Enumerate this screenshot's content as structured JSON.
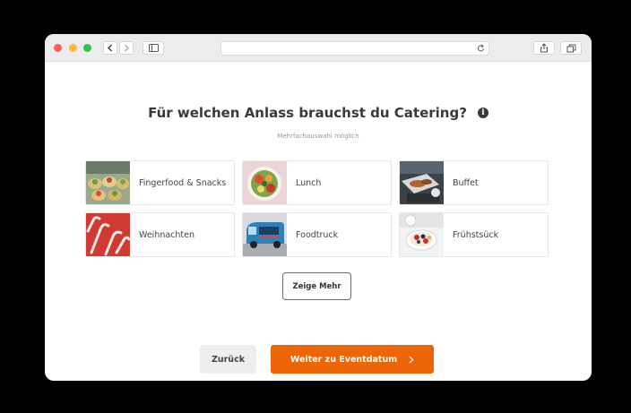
{
  "browser": {
    "url": ""
  },
  "page": {
    "title": "Für welchen Anlass brauchst du Catering?",
    "subtitle": "Mehrfachauswahl möglich"
  },
  "options": [
    {
      "label": "Fingerfood & Snacks",
      "image": "fingerfood-photo"
    },
    {
      "label": "Lunch",
      "image": "lunch-bowl-photo"
    },
    {
      "label": "Buffet",
      "image": "buffet-photo"
    },
    {
      "label": "Weihnachten",
      "image": "candy-cane-photo"
    },
    {
      "label": "Foodtruck",
      "image": "foodtruck-photo"
    },
    {
      "label": "Frühstsück",
      "image": "breakfast-photo"
    }
  ],
  "buttons": {
    "show_more": "Zeige Mehr",
    "back": "Zurück",
    "next": "Weiter zu Eventdatum"
  },
  "colors": {
    "accent": "#ec6608",
    "background": "#000000"
  }
}
